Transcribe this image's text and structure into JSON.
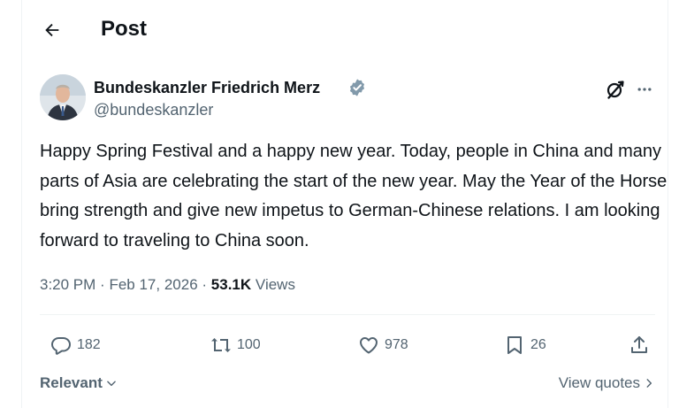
{
  "header": {
    "title": "Post"
  },
  "author": {
    "display_name": "Bundeskanzler Friedrich Merz",
    "handle": "@bundeskanzler",
    "verified": true
  },
  "post": {
    "text": "Happy Spring Festival and a happy new year. Today, people in China and many parts of Asia are celebrating the start of the new year. May the Year of the Horse bring strength and give new impetus to German-Chinese relations. I am looking forward to traveling to China soon."
  },
  "meta": {
    "time": "3:20 PM",
    "separator": "·",
    "date": "Feb 17, 2026",
    "views_count": "53.1K",
    "views_label": "Views"
  },
  "actions": {
    "replies": "182",
    "reposts": "100",
    "likes": "978",
    "bookmarks": "26"
  },
  "footer": {
    "sort_label": "Relevant",
    "view_quotes_label": "View quotes"
  },
  "colors": {
    "text": "#0f1419",
    "secondary": "#536471",
    "verified": "#829aab",
    "divider": "#eff3f4"
  }
}
